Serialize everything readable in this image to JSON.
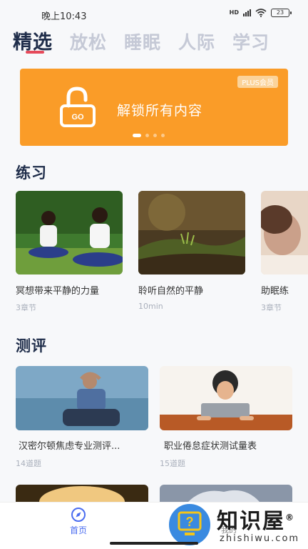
{
  "status": {
    "time": "晚上10:43",
    "hd": "HD",
    "battery": "23"
  },
  "tabs": [
    {
      "label": "精选",
      "active": true
    },
    {
      "label": "放松",
      "active": false
    },
    {
      "label": "睡眠",
      "active": false
    },
    {
      "label": "人际",
      "active": false
    },
    {
      "label": "学习",
      "active": false
    }
  ],
  "banner": {
    "badge": "PLUS会员",
    "text": "解锁所有内容",
    "lock_label": "GO",
    "page_index": 1,
    "page_count": 4
  },
  "practice": {
    "title": "练习",
    "items": [
      {
        "title": "冥想带来平静的力量",
        "meta": "3章节"
      },
      {
        "title": "聆听自然的平静",
        "meta": "10min"
      },
      {
        "title": "助眠练",
        "meta": "3章节"
      }
    ]
  },
  "assessment": {
    "title": "测评",
    "items": [
      {
        "title": "汉密尔顿焦虑专业测评...",
        "meta": "14道题"
      },
      {
        "title": "职业倦怠症状测试量表",
        "meta": "15道题"
      }
    ]
  },
  "nav": {
    "home": "首页",
    "mine": "我的"
  },
  "watermark": {
    "brand": "知识屋",
    "domain": "zhishiwu.com",
    "reg": "®"
  },
  "colors": {
    "accent": "#4a6cf0",
    "banner": "#fa9c28",
    "tab_indicator": "#e64a5a"
  }
}
